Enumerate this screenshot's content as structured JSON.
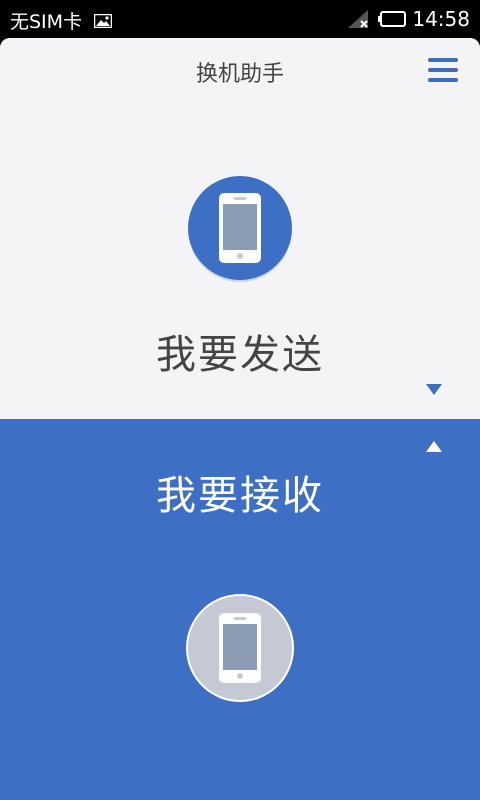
{
  "status_bar": {
    "carrier": "无SIM卡",
    "time": "14:58",
    "icons": [
      "image-icon",
      "signal-no-sim-icon",
      "battery-icon"
    ]
  },
  "header": {
    "title": "换机助手",
    "menu_icon": "hamburger-menu-icon"
  },
  "send": {
    "label": "我要发送",
    "icon": "phone-icon",
    "arrow_icon": "arrow-down-icon"
  },
  "receive": {
    "label": "我要接收",
    "icon": "phone-icon",
    "arrow_icon": "arrow-up-icon"
  },
  "colors": {
    "accent": "#3d70c4",
    "background": "#f4f4f6",
    "text": "#444444"
  }
}
